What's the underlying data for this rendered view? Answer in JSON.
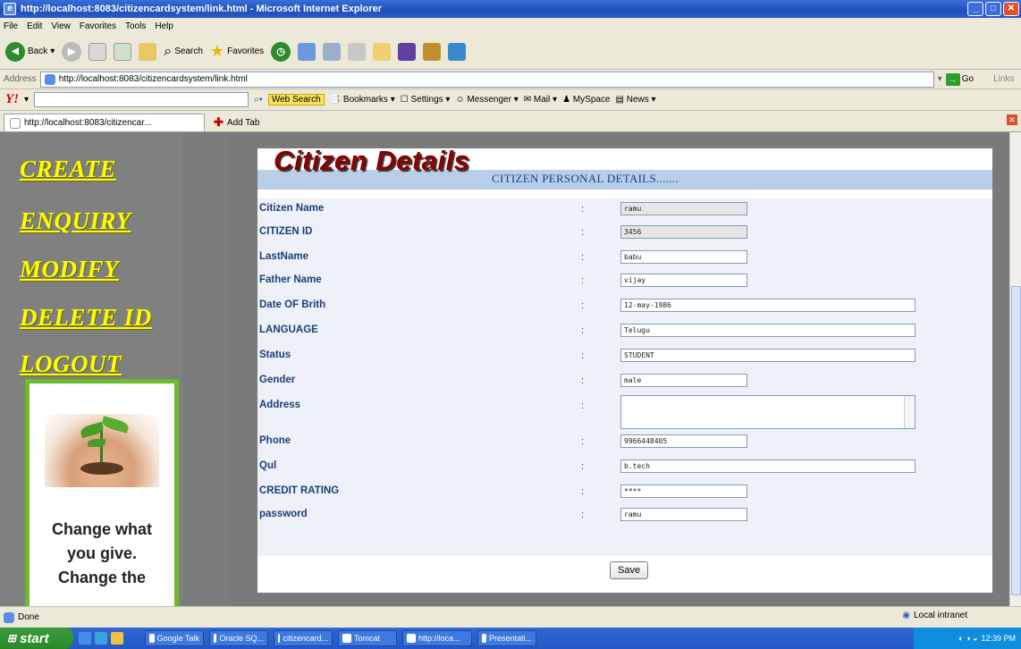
{
  "window": {
    "title": "http://localhost:8083/citizencardsystem/link.html - Microsoft Internet Explorer"
  },
  "menu": [
    "File",
    "Edit",
    "View",
    "Favorites",
    "Tools",
    "Help"
  ],
  "toolbar": {
    "back": "Back",
    "search": "Search",
    "favorites": "Favorites"
  },
  "address": {
    "label": "Address",
    "url": "http://localhost:8083/citizencardsystem/link.html",
    "go": "Go",
    "links": "Links"
  },
  "yahoo": {
    "logo": "Y!",
    "web_search": "Web Search",
    "bookmarks": "Bookmarks",
    "settings": "Settings",
    "messenger": "Messenger",
    "mail": "Mail",
    "myspace": "MySpace",
    "news": "News"
  },
  "tabs": {
    "active": "http://localhost:8083/citizencar...",
    "add": "Add Tab"
  },
  "sidebar": {
    "items": [
      "CREATE",
      "ENQUIRY",
      "MODIFY",
      "DELETE ID",
      "LOGOUT"
    ],
    "promo_lines": [
      "Change what",
      "you give.",
      "Change the"
    ]
  },
  "page": {
    "title": "Citizen Details",
    "section": "CITIZEN PERSONAL DETAILS.......",
    "fields": [
      {
        "label": "Citizen Name",
        "value": "ramu",
        "readonly": true
      },
      {
        "label": "CITIZEN ID",
        "value": "3456",
        "readonly": true
      },
      {
        "label": "LastName",
        "value": "babu"
      },
      {
        "label": "Father Name",
        "value": "vijay"
      },
      {
        "label": "Date OF Brith",
        "value": "12-may-1986"
      },
      {
        "label": "LANGUAGE",
        "value": "Telugu"
      },
      {
        "label": "Status",
        "value": "STUDENT"
      },
      {
        "label": "Gender",
        "value": "male"
      },
      {
        "label": "Address",
        "value": ""
      },
      {
        "label": "Phone",
        "value": "9966448405"
      },
      {
        "label": "Qul",
        "value": "b.tech"
      },
      {
        "label": "CREDIT RATING",
        "value": "****"
      },
      {
        "label": "password",
        "value": "ramu"
      }
    ],
    "colon": ":",
    "save": "Save"
  },
  "status": {
    "left": "Done",
    "zone": "Local intranet"
  },
  "taskbar": {
    "start": "start",
    "items": [
      "Google Talk",
      "Oracle SQ...",
      "citizencard...",
      "Tomcat",
      "http://loca...",
      "Presentati..."
    ],
    "clock": "12:39 PM"
  }
}
